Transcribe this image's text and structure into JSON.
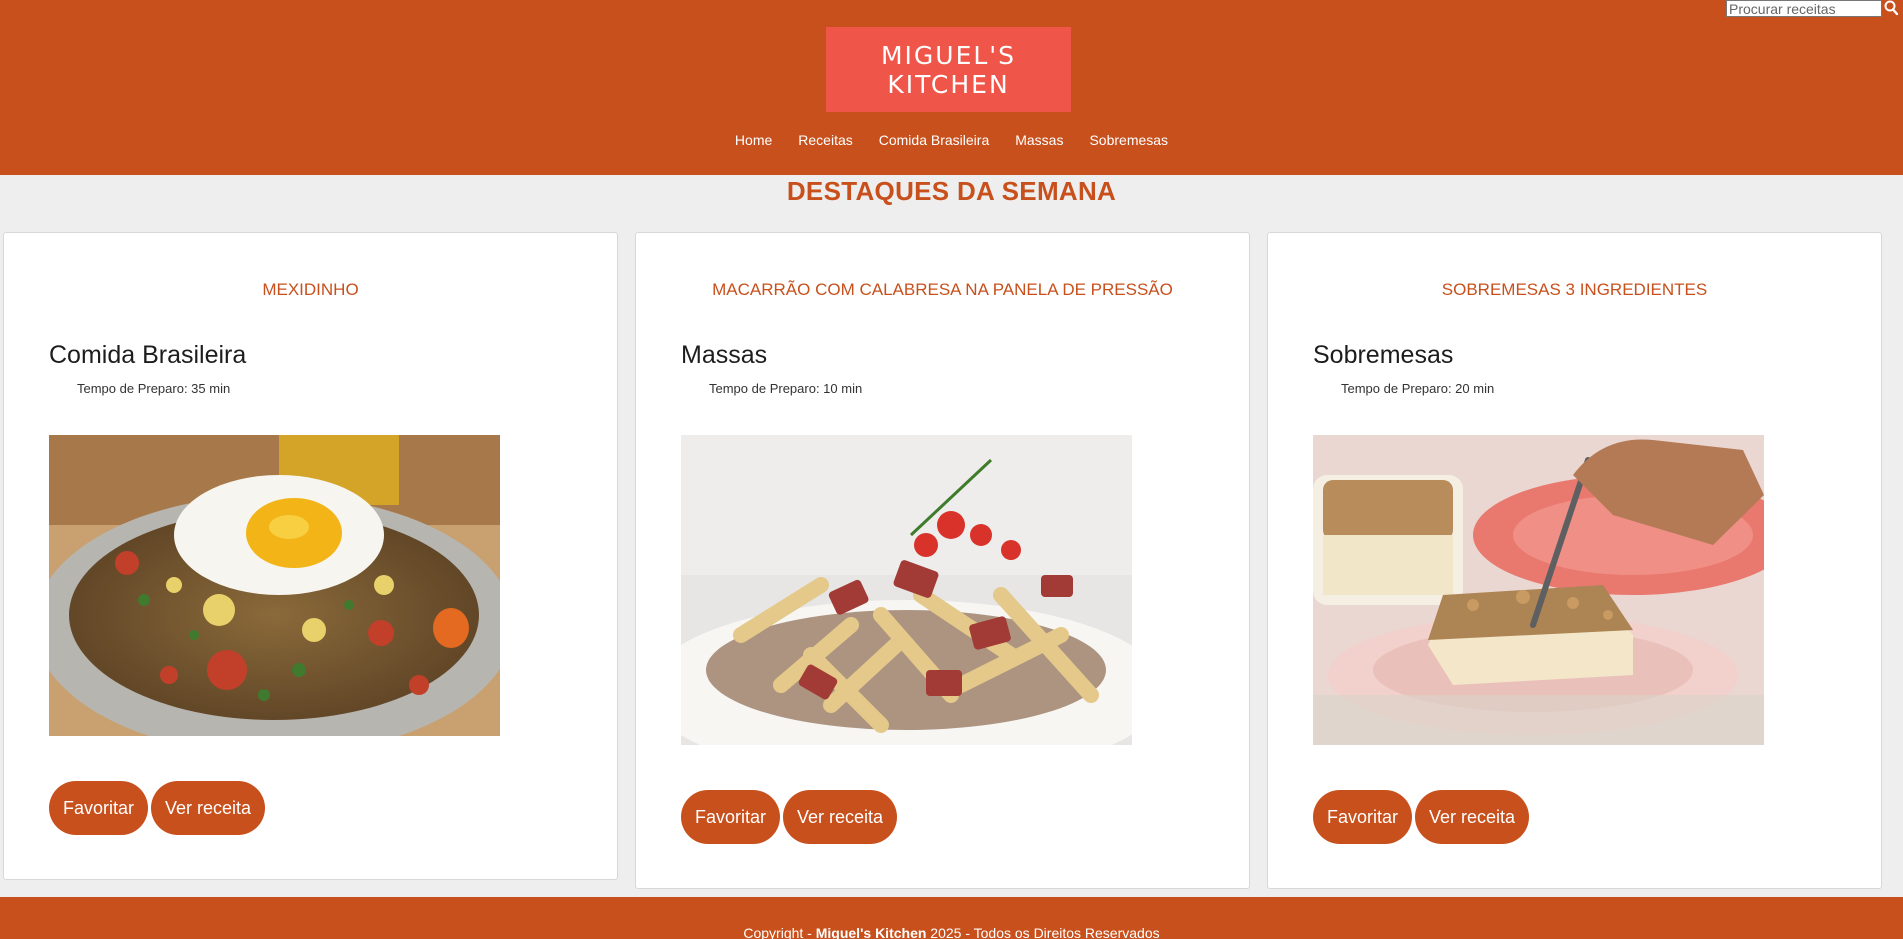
{
  "header": {
    "logo_line1": "MIGUEL'S",
    "logo_line2": "KITCHEN",
    "search_placeholder": "Procurar receitas",
    "nav": [
      "Home",
      "Receitas",
      "Comida Brasileira",
      "Massas",
      "Sobremesas"
    ]
  },
  "section_title": "DESTAQUES DA SEMANA",
  "cards": [
    {
      "title": "MEXIDINHO",
      "category": "Comida Brasileira",
      "prep": "Tempo de Preparo: 35 min",
      "fav": "Favoritar",
      "view": "Ver receita"
    },
    {
      "title": "MACARRÃO COM CALABRESA NA PANELA DE PRESSÃO",
      "category": "Massas",
      "prep": "Tempo de Preparo: 10 min",
      "fav": "Favoritar",
      "view": "Ver receita"
    },
    {
      "title": "SOBREMESAS 3 INGREDIENTES",
      "category": "Sobremesas",
      "prep": "Tempo de Preparo: 20 min",
      "fav": "Favoritar",
      "view": "Ver receita"
    }
  ],
  "footer": {
    "prefix": "Copyright - ",
    "brand": "Miguel's Kitchen",
    "suffix": " 2025 - Todos os Direitos Reservados"
  },
  "colors": {
    "brand": "#c8501c",
    "logo_bg": "#ef5548",
    "page_bg": "#efeeee"
  },
  "icons": {
    "search": "search-icon"
  }
}
